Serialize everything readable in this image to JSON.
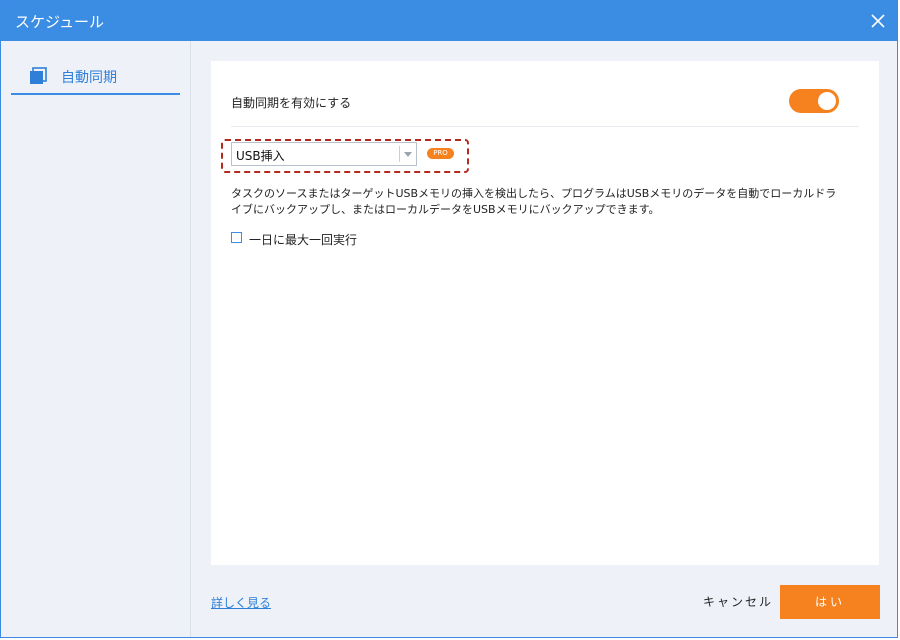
{
  "window": {
    "title": "スケジュール",
    "accent_color": "#3b8de4",
    "orange_color": "#f5821f"
  },
  "sidebar": {
    "items": [
      {
        "label": "自動同期",
        "icon": "copy-icon",
        "active": true
      }
    ]
  },
  "panel": {
    "enable_label": "自動同期を有効にする",
    "enable_toggle_on": true,
    "trigger_select": {
      "value": "USB挿入"
    },
    "pro_badge": "PRO",
    "description": "タスクのソースまたはターゲットUSBメモリの挿入を検出したら、プログラムはUSBメモリのデータを自動でローカルドライブにバックアップし、またはローカルデータをUSBメモリにバックアップできます。",
    "once_per_day_label": "一日に最大一回実行",
    "once_per_day_checked": false
  },
  "footer": {
    "more_link": "詳しく見る",
    "cancel_label": "キャンセル",
    "ok_label": "はい"
  }
}
